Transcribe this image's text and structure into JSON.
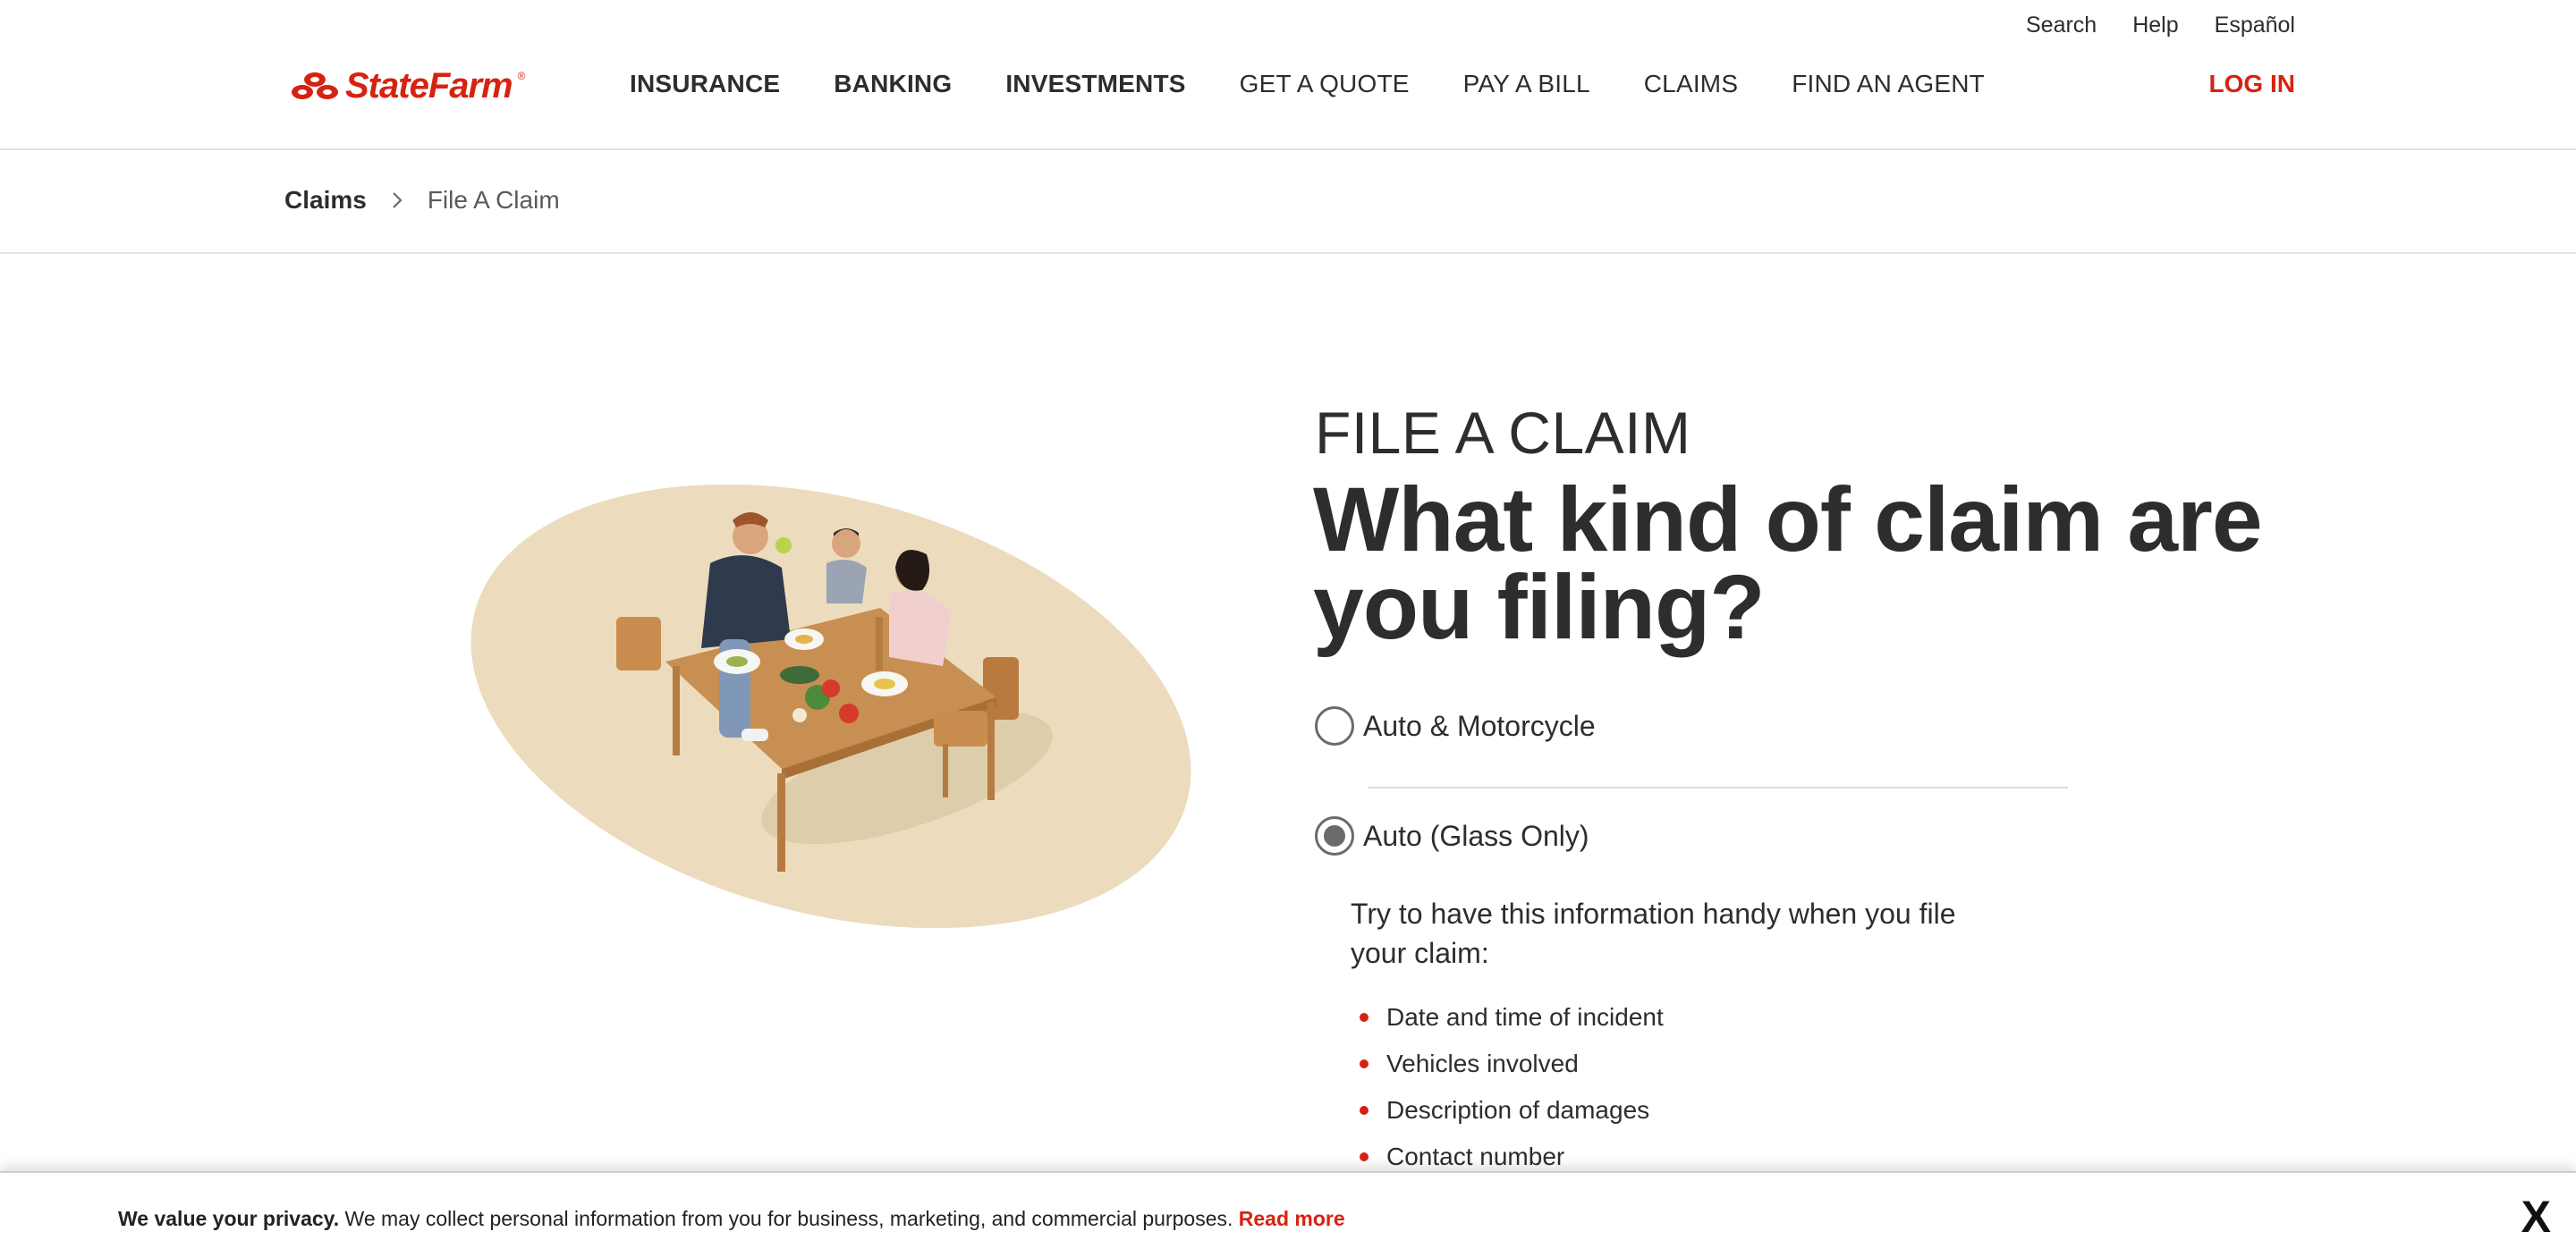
{
  "utility_nav": [
    "Search",
    "Help",
    "Español"
  ],
  "logo": {
    "text": "StateFarm",
    "reg": "®"
  },
  "nav": {
    "items": [
      "INSURANCE",
      "BANKING",
      "INVESTMENTS",
      "GET A QUOTE",
      "PAY A BILL",
      "CLAIMS",
      "FIND AN AGENT"
    ],
    "login": "LOG IN"
  },
  "breadcrumb": {
    "parent": "Claims",
    "current": "File A Claim"
  },
  "main": {
    "eyebrow": "FILE A CLAIM",
    "headline": "What kind of claim are you filing?",
    "options": [
      {
        "label": "Auto & Motorcycle",
        "selected": false
      },
      {
        "label": "Auto (Glass Only)",
        "selected": true
      }
    ],
    "info_text": "Try to have this information handy when you file your claim:",
    "checklist": [
      "Date and time of incident",
      "Vehicles involved",
      "Description of damages",
      "Contact number"
    ]
  },
  "privacy": {
    "bold": "We value your privacy.",
    "text": " We may collect personal information from you for business, marketing, and commercial purposes.",
    "link": "Read more",
    "close": "X"
  },
  "colors": {
    "brand_red": "#d62311",
    "illustration_ellipse": "#ecdcbd",
    "text": "#2d2d2d"
  }
}
